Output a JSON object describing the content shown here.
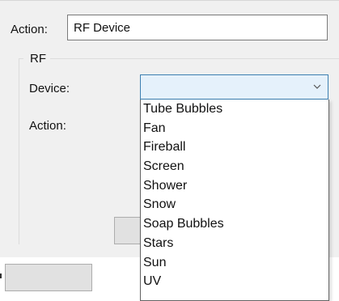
{
  "form": {
    "action_label": "Action:",
    "action_value": "RF Device"
  },
  "group": {
    "title": "RF",
    "device_label": "Device:",
    "action_label": "Action:"
  },
  "device_combo": {
    "selected_value": "",
    "arrow_icon": "chevron-down-icon",
    "options": [
      "Tube Bubbles",
      "Fan",
      "Fireball",
      "Screen",
      "Shower",
      "Snow",
      "Soap Bubbles",
      "Stars",
      "Sun",
      "UV"
    ]
  },
  "colors": {
    "dialog_background": "#f0f0f0",
    "combo_focus_border": "#3c7fb1",
    "combo_focus_fill": "#e5f1fb"
  }
}
